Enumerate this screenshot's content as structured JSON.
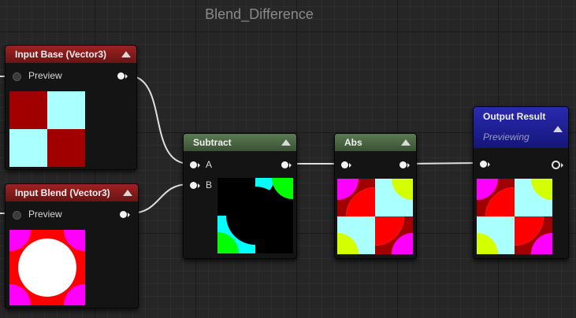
{
  "graph": {
    "title": "Blend_Difference"
  },
  "nodes": {
    "input_base": {
      "title": "Input Base (Vector3)",
      "pin_label": "Preview"
    },
    "input_blend": {
      "title": "Input Blend (Vector3)",
      "pin_label": "Preview"
    },
    "subtract": {
      "title": "Subtract",
      "pin_a": "A",
      "pin_b": "B"
    },
    "abs": {
      "title": "Abs"
    },
    "output": {
      "title": "Output Result",
      "subtitle": "Previewing"
    }
  },
  "colors": {
    "base_red": "#a00000",
    "base_cyan": "#aaffff",
    "blend_magenta": "#ff00ff",
    "blend_red": "#ff0000",
    "abs_yellow": "#d4ff00",
    "output_header": "#1e1e96"
  }
}
